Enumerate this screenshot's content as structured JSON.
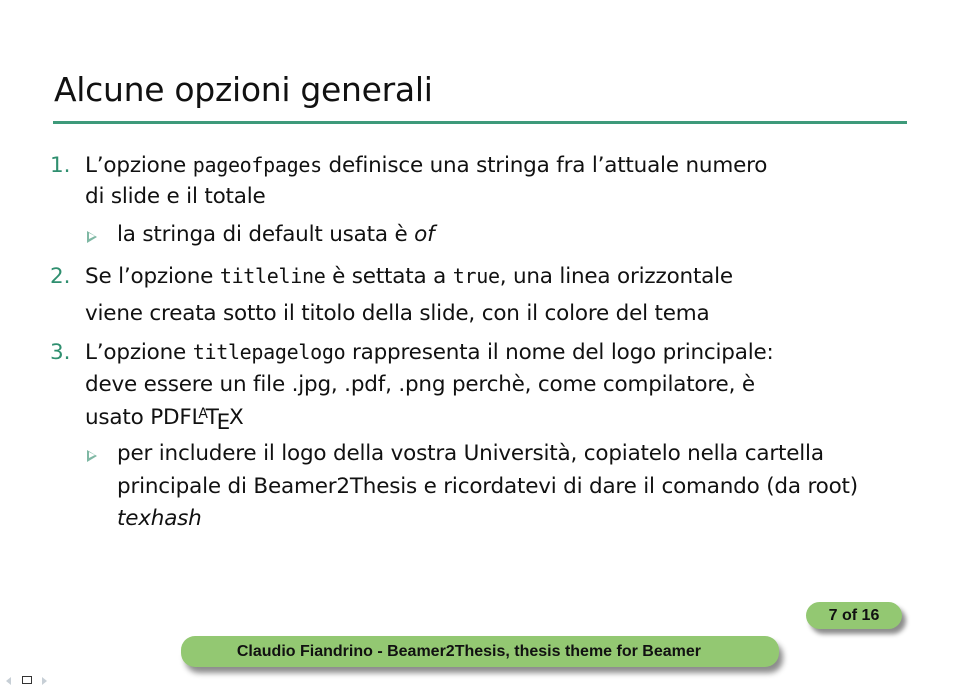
{
  "slide": {
    "title": "Alcune opzioni generali",
    "accent_color": "#3e9a7a",
    "items": [
      {
        "number": "1.",
        "lines": [
          {
            "parts": [
              {
                "text": "L’opzione ",
                "style": "normal"
              },
              {
                "text": "pageofpages",
                "style": "mono"
              },
              {
                "text": " definisce una stringa fra l’attuale numero",
                "style": "normal"
              }
            ]
          },
          {
            "parts": [
              {
                "text": "di slide e il totale",
                "style": "normal"
              }
            ]
          }
        ],
        "subitems": [
          {
            "lines": [
              {
                "parts": [
                  {
                    "text": "la stringa di default usata è ",
                    "style": "normal"
                  },
                  {
                    "text": "of",
                    "style": "italic"
                  }
                ]
              }
            ]
          }
        ]
      },
      {
        "number": "2.",
        "lines": [
          {
            "parts": [
              {
                "text": "Se l’opzione ",
                "style": "normal"
              },
              {
                "text": "titleline",
                "style": "mono"
              },
              {
                "text": " è settata a ",
                "style": "normal"
              },
              {
                "text": "true",
                "style": "mono"
              },
              {
                "text": ", una linea orizzontale",
                "style": "normal"
              }
            ]
          },
          {
            "parts": [
              {
                "text": "viene creata sotto il titolo della slide, con il colore del tema",
                "style": "normal"
              }
            ]
          }
        ],
        "subitems": []
      },
      {
        "number": "3.",
        "lines": [
          {
            "parts": [
              {
                "text": "L’opzione ",
                "style": "normal"
              },
              {
                "text": "titlepagelogo",
                "style": "mono"
              },
              {
                "text": " rappresenta il nome del logo principale:",
                "style": "normal"
              }
            ]
          },
          {
            "parts": [
              {
                "text": "deve essere un file .jpg, .pdf, .png perchè, come compilatore, è",
                "style": "normal"
              }
            ]
          },
          {
            "parts": [
              {
                "text": "usato ",
                "style": "normal"
              },
              {
                "text": "PDFLATEX",
                "style": "latex"
              }
            ]
          }
        ],
        "subitems": [
          {
            "lines": [
              {
                "parts": [
                  {
                    "text": "per includere il logo della vostra Università, copiatelo nella cartella",
                    "style": "normal"
                  }
                ]
              },
              {
                "parts": [
                  {
                    "text": "principale di Beamer2Thesis e ricordatevi di dare il comando (da root)",
                    "style": "normal"
                  }
                ]
              },
              {
                "parts": [
                  {
                    "text": "texhash",
                    "style": "italic"
                  }
                ]
              }
            ]
          }
        ]
      }
    ]
  },
  "footer": {
    "text": "Claudio Fiandrino - Beamer2Thesis, thesis theme for Beamer",
    "page_label": "7 of 16",
    "current_page": 7,
    "total_pages": 16,
    "bar_color": "#93c872"
  },
  "navigation": {
    "prev_icon": "nav-left-arrow-icon",
    "frame_icon": "nav-frame-icon",
    "next_icon": "nav-right-arrow-icon"
  }
}
